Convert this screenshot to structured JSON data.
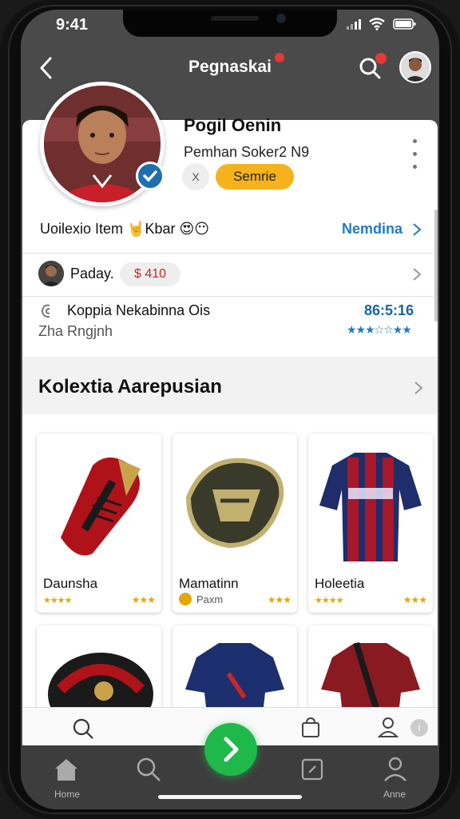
{
  "status_bar": {
    "time": "9:41"
  },
  "header": {
    "title": "Pegnaskai"
  },
  "profile": {
    "name": "Pogil Oenin",
    "subtitle": "Pemhan Soker2 N9",
    "share_label": "X",
    "follow_label": "Semrie"
  },
  "info_rows": {
    "collection": {
      "label": "Uoilexio Item 🤘Kbar 😍😶",
      "link": "Nemdina"
    },
    "price": {
      "label": "Paday.",
      "value": "$ 410"
    },
    "location": {
      "line1": "Koppia Nekabinna Ois",
      "line2": "Zha Rngjnh",
      "score": "86:5:16",
      "rating": "★★★☆☆★★"
    }
  },
  "section": {
    "title": "Kolextia Aarepusian"
  },
  "items": [
    {
      "name": "Daunsha",
      "sub": "",
      "stars_left": "★★★★",
      "stars_right": "★★★"
    },
    {
      "name": "Mamatinn",
      "sub": "Paxm",
      "stars_left": "",
      "stars_right": "★★★"
    },
    {
      "name": "Holeetia",
      "sub": "",
      "stars_left": "★★★★",
      "stars_right": "★★★"
    }
  ],
  "bottom_nav": {
    "home_label": "Home",
    "profile_label": "Anne"
  },
  "colors": {
    "accent": "#1d7cc5",
    "follow": "#f5b21c",
    "fab": "#1fb84a",
    "price": "#c62828"
  }
}
